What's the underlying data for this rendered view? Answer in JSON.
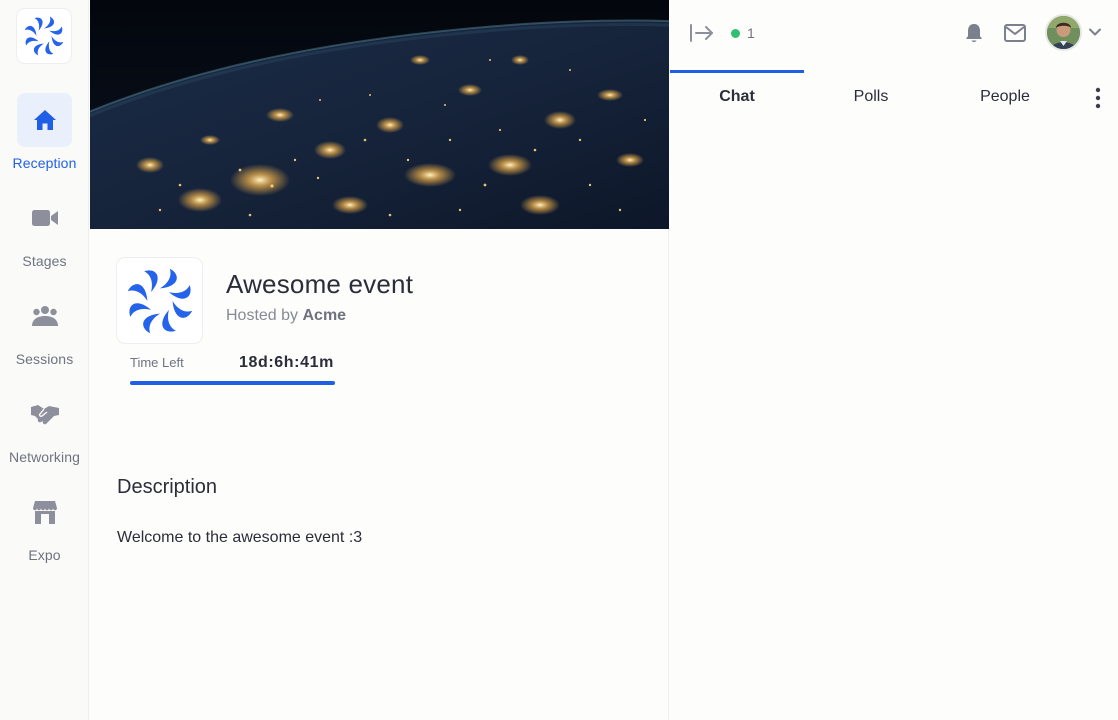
{
  "nav": {
    "logo_icon": "company-logo",
    "items": [
      {
        "label": "Reception",
        "icon": "home-icon",
        "active": true
      },
      {
        "label": "Stages",
        "icon": "video-camera-icon",
        "active": false
      },
      {
        "label": "Sessions",
        "icon": "group-icon",
        "active": false
      },
      {
        "label": "Networking",
        "icon": "handshake-icon",
        "active": false
      },
      {
        "label": "Expo",
        "icon": "storefront-icon",
        "active": false
      }
    ]
  },
  "event": {
    "title": "Awesome event",
    "hosted_by_prefix": "Hosted by",
    "host": "Acme",
    "time_left_label": "Time Left",
    "time_left_value": "18d:6h:41m",
    "time_left_progress": 1.0,
    "description_heading": "Description",
    "description_text": "Welcome to the awesome event :3"
  },
  "panel": {
    "online_count": "1",
    "tabs": [
      {
        "label": "Chat",
        "active": true
      },
      {
        "label": "Polls",
        "active": false
      },
      {
        "label": "People",
        "active": false
      }
    ]
  },
  "colors": {
    "accent": "#1f5fe6",
    "online": "#2fbf71",
    "nav_active_bg": "#e9effb"
  }
}
